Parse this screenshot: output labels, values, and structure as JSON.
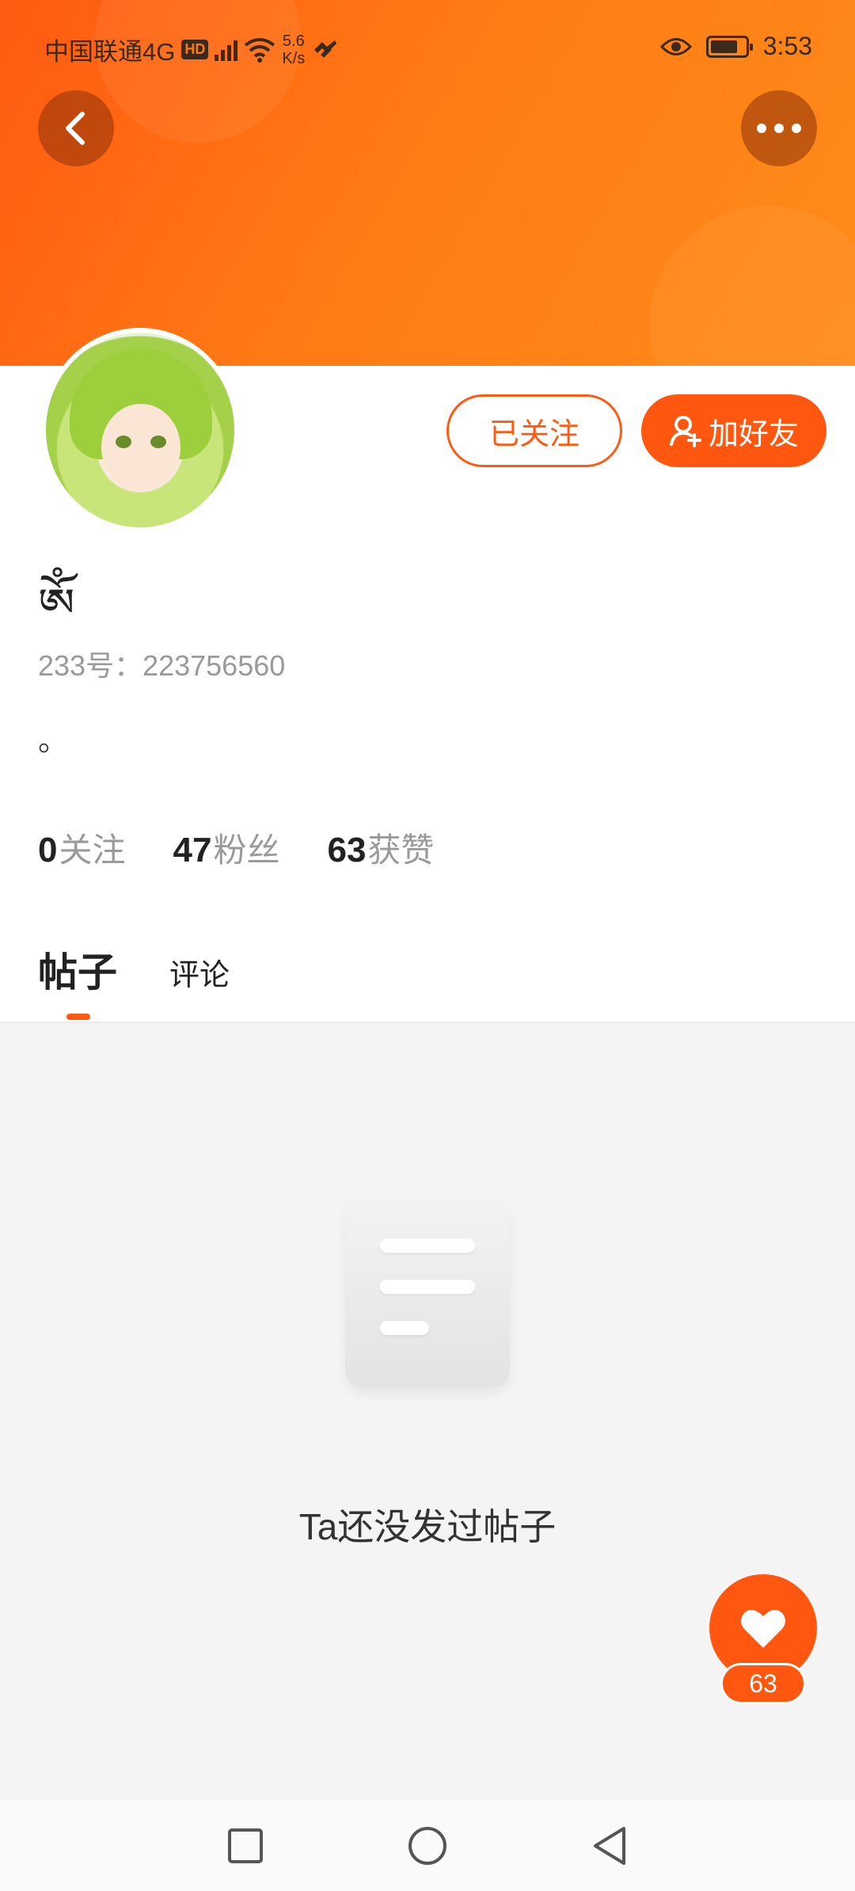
{
  "status_bar": {
    "carrier": "中国联通4G",
    "hd_badge": "HD",
    "network": "4G",
    "speed_value": "5.6",
    "speed_unit": "K/s",
    "time": "3:53"
  },
  "header": {
    "back_icon": "chevron-left-icon",
    "more_icon": "more-dots-icon",
    "accent_color": "#ff5a12"
  },
  "profile": {
    "username": "ཨོཾ",
    "uid_text": "233号：223756560",
    "bio": "。",
    "followed_label": "已关注",
    "add_friend_label": "加好友"
  },
  "stats": {
    "following_count": "0",
    "following_label": "关注",
    "fans_count": "47",
    "fans_label": "粉丝",
    "likes_count": "63",
    "likes_label": "获赞"
  },
  "tabs": {
    "posts": "帖子",
    "comments": "评论"
  },
  "empty_state": {
    "message": "Ta还没发过帖子"
  },
  "like_fab": {
    "count": "63"
  },
  "nav": {
    "recent_icon": "square-icon",
    "home_icon": "circle-icon",
    "back_icon": "triangle-back-icon"
  }
}
